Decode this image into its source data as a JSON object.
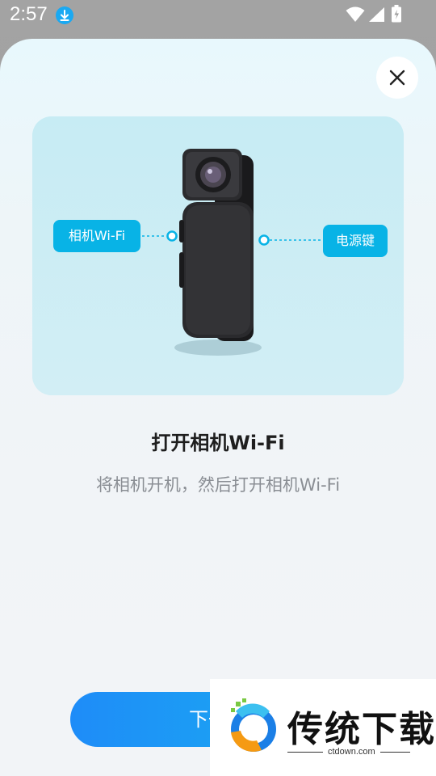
{
  "status_bar": {
    "time": "2:57",
    "icons": [
      "download-icon",
      "wifi-icon",
      "signal-icon",
      "battery-charging-icon"
    ]
  },
  "dialog": {
    "close_icon": "close-icon",
    "hero": {
      "labels": {
        "left": "相机Wi-Fi",
        "right": "电源键"
      }
    },
    "title": "打开相机Wi-Fi",
    "subtitle": "将相机开机，然后打开相机Wi-Fi",
    "next_button": "下一步"
  },
  "watermark": {
    "brand": "传统下载",
    "url": "ctdown.com"
  },
  "colors": {
    "accent": "#08b3e6",
    "button_start": "#1e8cf8",
    "button_end": "#1ab0f0",
    "hero_bg": "#cdeff5"
  }
}
